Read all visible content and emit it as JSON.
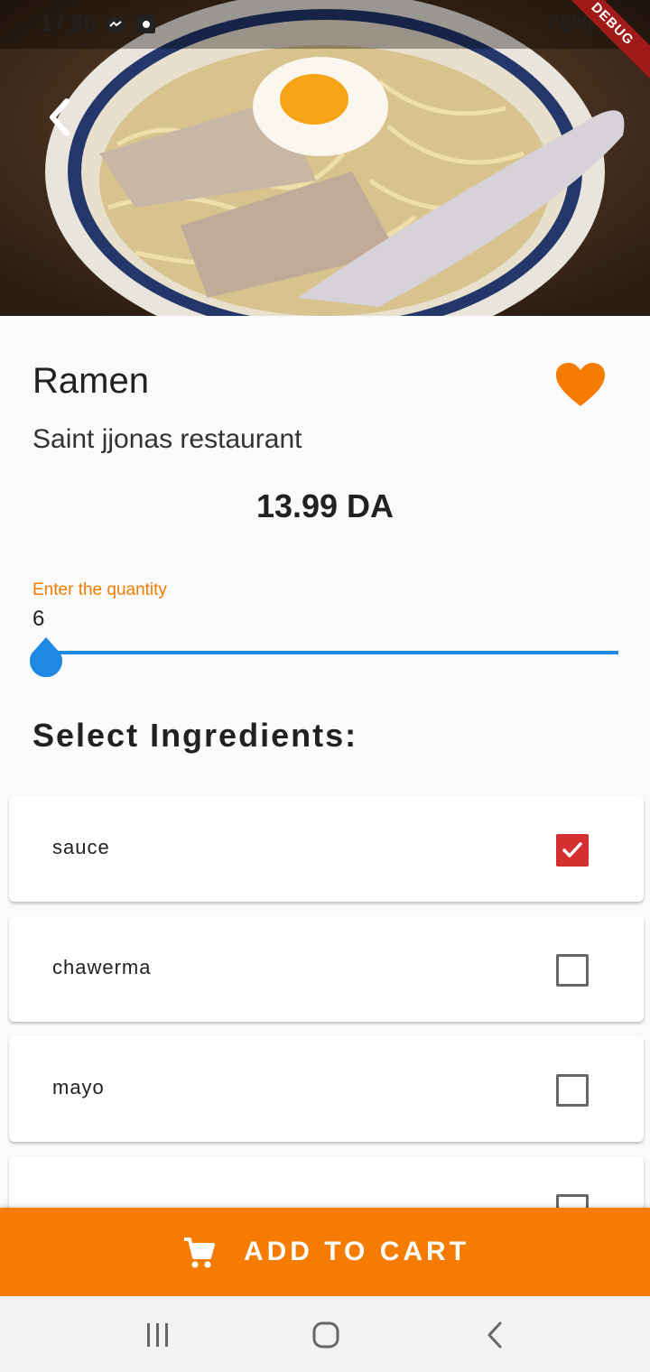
{
  "status_bar": {
    "time": "17:56",
    "battery": "78%",
    "debug": "DEBUG"
  },
  "header": {
    "back_icon": "chevron-left-icon"
  },
  "product": {
    "name": "Ramen",
    "restaurant": "Saint jjonas restaurant",
    "price": "13.99 DA",
    "favorite_icon": "heart-icon",
    "favorite_color": "#f57c00"
  },
  "quantity": {
    "label": "Enter the quantity",
    "value": "6",
    "slider_fraction": 0.0
  },
  "ingredients": {
    "title": "Select Ingredients:",
    "items": [
      {
        "label": "sauce",
        "checked": true
      },
      {
        "label": "chawerma",
        "checked": false
      },
      {
        "label": "mayo",
        "checked": false
      },
      {
        "label": "",
        "checked": false
      }
    ]
  },
  "cart": {
    "label": "ADD TO CART",
    "icon": "cart-icon"
  },
  "colors": {
    "accent": "#f57c00",
    "slider": "#1e88e5",
    "check": "#d32f2f"
  },
  "nav": {
    "recents_icon": "recents-icon",
    "home_icon": "home-icon",
    "back_icon": "back-icon"
  }
}
